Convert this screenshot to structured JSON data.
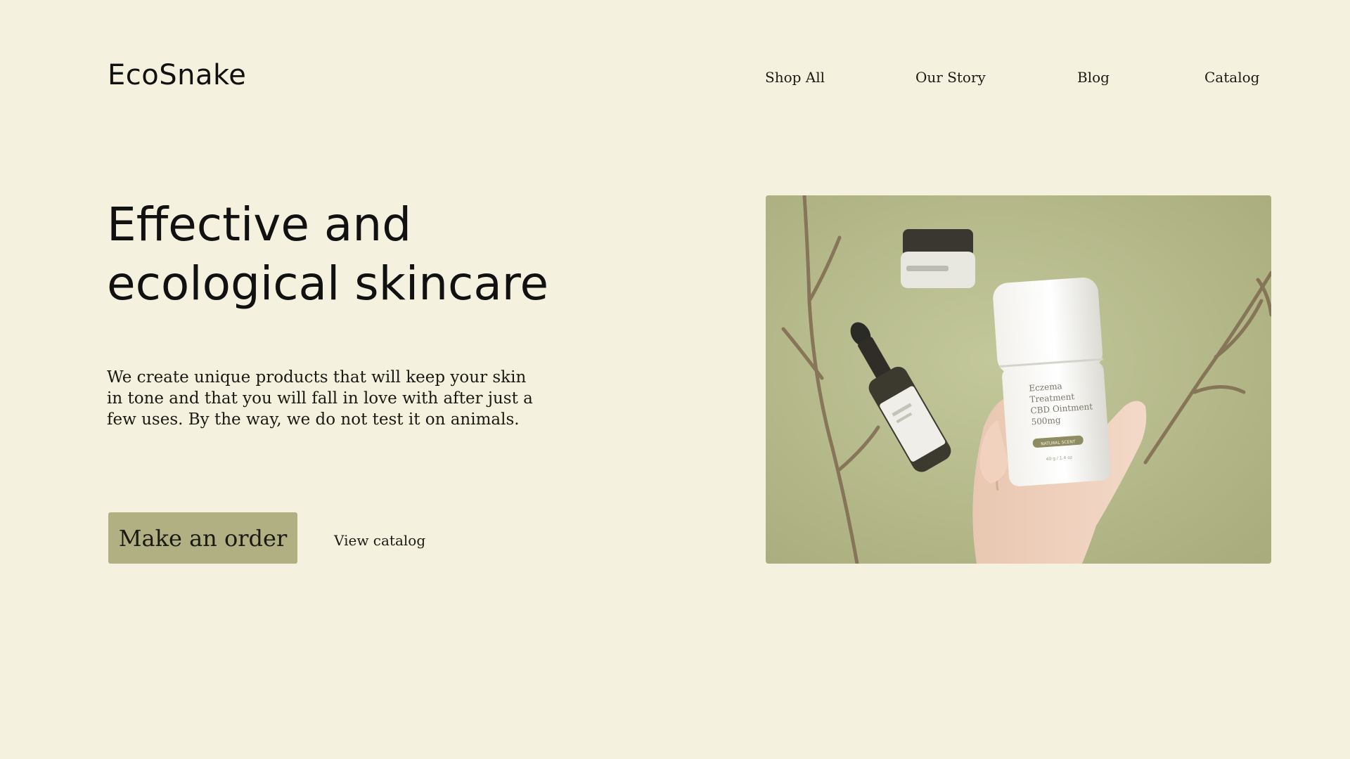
{
  "brand": {
    "logo_text": "EcoSnake"
  },
  "nav": {
    "items": [
      {
        "label": "Shop All"
      },
      {
        "label": "Our Story"
      },
      {
        "label": "Blog"
      },
      {
        "label": "Catalog"
      }
    ]
  },
  "hero": {
    "title_line1": "Effective and",
    "title_line2": "ecological skincare",
    "description": "We create unique products that will keep your skin in tone and that you will fall in love with after just a few uses. By the way, we do not test it on animals.",
    "primary_button_label": "Make an order",
    "secondary_link_label": "View catalog",
    "image": {
      "alt": "product-photo",
      "jar_label_line1": "Eczema",
      "jar_label_line2": "Treatment",
      "jar_label_line3": "CBD Ointment",
      "jar_label_line4": "500mg",
      "jar_badge": "NATURAL SCENT",
      "jar_weight": "40 g / 1.4 oz"
    }
  },
  "colors": {
    "background": "#f4f2de",
    "button": "#b1b083",
    "text": "#1a1a14",
    "photo_background": "#b7bb8c"
  }
}
